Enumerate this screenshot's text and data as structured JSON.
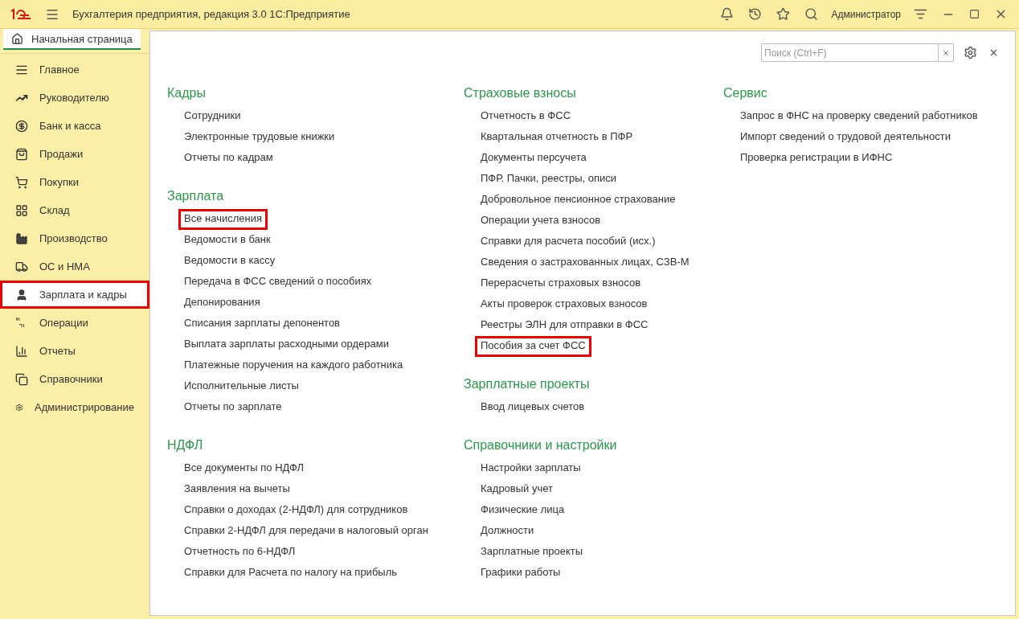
{
  "window": {
    "title": "Бухгалтерия предприятия, редакция 3.0 1С:Предприятие",
    "user": "Администратор"
  },
  "tab": {
    "label": "Начальная страница",
    "selected": true
  },
  "sidebar": {
    "items": [
      {
        "label": "Главное",
        "selected": false,
        "highlighted": false
      },
      {
        "label": "Руководителю",
        "selected": false,
        "highlighted": false
      },
      {
        "label": "Банк и касса",
        "selected": false,
        "highlighted": false
      },
      {
        "label": "Продажи",
        "selected": false,
        "highlighted": false
      },
      {
        "label": "Покупки",
        "selected": false,
        "highlighted": false
      },
      {
        "label": "Склад",
        "selected": false,
        "highlighted": false
      },
      {
        "label": "Производство",
        "selected": false,
        "highlighted": false
      },
      {
        "label": "ОС и НМА",
        "selected": false,
        "highlighted": false
      },
      {
        "label": "Зарплата и кадры",
        "selected": true,
        "highlighted": true
      },
      {
        "label": "Операции",
        "selected": false,
        "highlighted": false
      },
      {
        "label": "Отчеты",
        "selected": false,
        "highlighted": false
      },
      {
        "label": "Справочники",
        "selected": false,
        "highlighted": false
      },
      {
        "label": "Администрирование",
        "selected": false,
        "highlighted": false
      }
    ]
  },
  "search": {
    "placeholder": "Поиск (Ctrl+F)"
  },
  "columns": [
    {
      "sections": [
        {
          "title": "Кадры",
          "links": [
            {
              "label": "Сотрудники",
              "highlighted": false
            },
            {
              "label": "Электронные трудовые книжки",
              "highlighted": false
            },
            {
              "label": "Отчеты по кадрам",
              "highlighted": false
            }
          ]
        },
        {
          "title": "Зарплата",
          "links": [
            {
              "label": "Все начисления",
              "highlighted": true
            },
            {
              "label": "Ведомости в банк",
              "highlighted": false
            },
            {
              "label": "Ведомости в кассу",
              "highlighted": false
            },
            {
              "label": "Передача в ФСС сведений о пособиях",
              "highlighted": false
            },
            {
              "label": "Депонирования",
              "highlighted": false
            },
            {
              "label": "Списания зарплаты депонентов",
              "highlighted": false
            },
            {
              "label": "Выплата зарплаты расходными ордерами",
              "highlighted": false
            },
            {
              "label": "Платежные поручения на каждого работника",
              "highlighted": false
            },
            {
              "label": "Исполнительные листы",
              "highlighted": false
            },
            {
              "label": "Отчеты по зарплате",
              "highlighted": false
            }
          ]
        },
        {
          "title": "НДФЛ",
          "links": [
            {
              "label": "Все документы по НДФЛ",
              "highlighted": false
            },
            {
              "label": "Заявления на вычеты",
              "highlighted": false
            },
            {
              "label": "Справки о доходах (2-НДФЛ) для сотрудников",
              "highlighted": false
            },
            {
              "label": "Справки 2-НДФЛ для передачи в налоговый орган",
              "highlighted": false
            },
            {
              "label": "Отчетность по 6-НДФЛ",
              "highlighted": false
            },
            {
              "label": "Справки для Расчета по налогу на прибыль",
              "highlighted": false
            }
          ]
        }
      ]
    },
    {
      "sections": [
        {
          "title": "Страховые взносы",
          "links": [
            {
              "label": "Отчетность в ФСС",
              "highlighted": false
            },
            {
              "label": "Квартальная отчетность в ПФР",
              "highlighted": false
            },
            {
              "label": "Документы персучета",
              "highlighted": false
            },
            {
              "label": "ПФР. Пачки, реестры, описи",
              "highlighted": false
            },
            {
              "label": "Добровольное пенсионное страхование",
              "highlighted": false
            },
            {
              "label": "Операции учета взносов",
              "highlighted": false
            },
            {
              "label": "Справки для расчета пособий (исх.)",
              "highlighted": false
            },
            {
              "label": "Сведения о застрахованных лицах, СЗВ-М",
              "highlighted": false
            },
            {
              "label": "Перерасчеты страховых взносов",
              "highlighted": false
            },
            {
              "label": "Акты проверок страховых взносов",
              "highlighted": false
            },
            {
              "label": "Реестры ЭЛН для отправки в ФСС",
              "highlighted": false
            },
            {
              "label": "Пособия за счет ФСС",
              "highlighted": true
            }
          ]
        },
        {
          "title": "Зарплатные проекты",
          "links": [
            {
              "label": "Ввод лицевых счетов",
              "highlighted": false
            }
          ]
        },
        {
          "title": "Справочники и настройки",
          "links": [
            {
              "label": "Настройки зарплаты",
              "highlighted": false
            },
            {
              "label": "Кадровый учет",
              "highlighted": false
            },
            {
              "label": "Физические лица",
              "highlighted": false
            },
            {
              "label": "Должности",
              "highlighted": false
            },
            {
              "label": "Зарплатные проекты",
              "highlighted": false
            },
            {
              "label": "Графики работы",
              "highlighted": false
            }
          ]
        }
      ]
    },
    {
      "sections": [
        {
          "title": "Сервис",
          "links": [
            {
              "label": "Запрос в ФНС на проверку сведений работников",
              "highlighted": false
            },
            {
              "label": "Импорт сведений о трудовой деятельности",
              "highlighted": false
            },
            {
              "label": "Проверка регистрации в ИФНС",
              "highlighted": false
            }
          ]
        }
      ]
    }
  ]
}
